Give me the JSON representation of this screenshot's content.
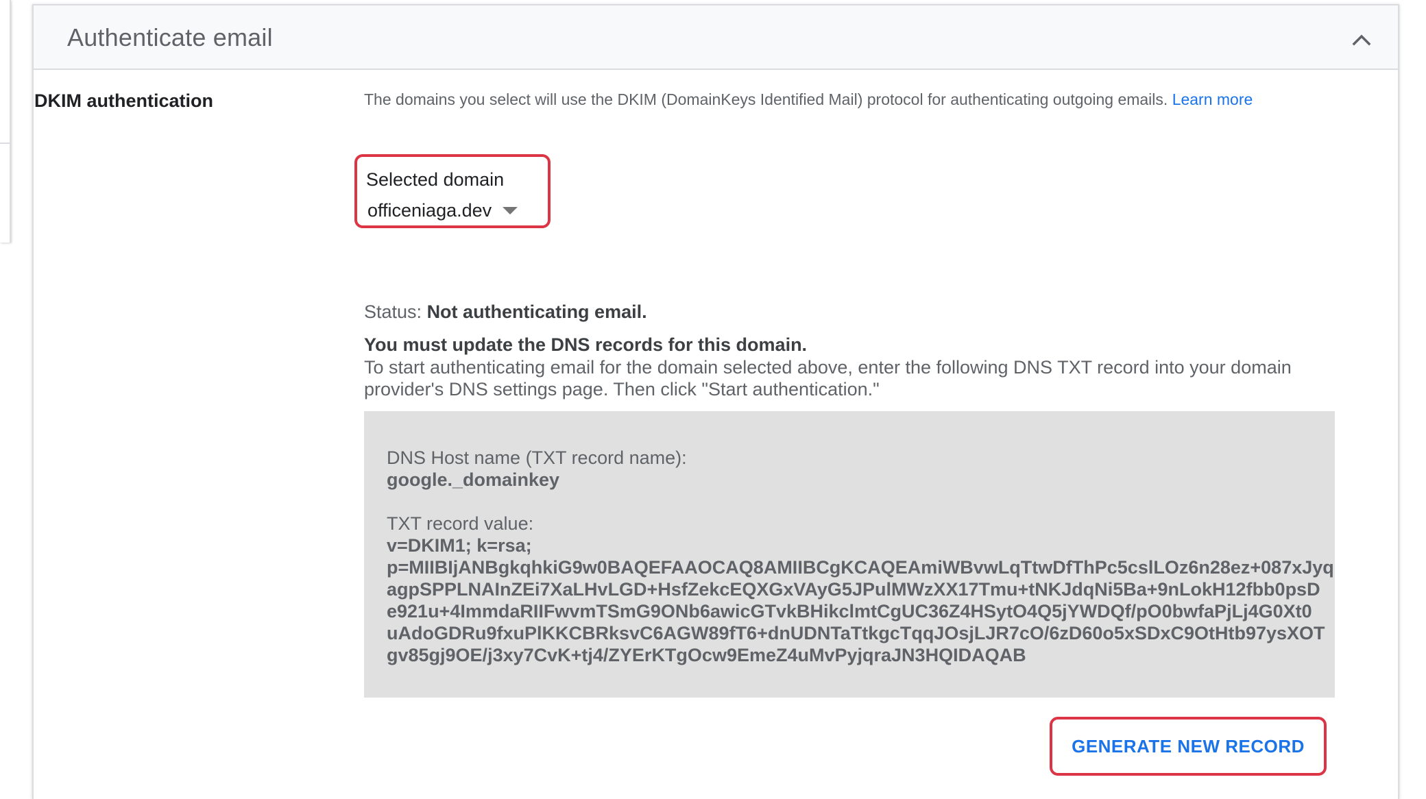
{
  "panel": {
    "title": "Authenticate email",
    "collapse_icon": "chevron-up-icon"
  },
  "dkim": {
    "label": "DKIM authentication",
    "description": "The domains you select will use the DKIM (DomainKeys Identified Mail) protocol for authenticating outgoing emails.",
    "learn_more": "Learn more"
  },
  "domain": {
    "label": "Selected domain",
    "value": "officeniaga.dev",
    "dropdown_icon": "caret-down-icon"
  },
  "status": {
    "prefix": "Status:",
    "value": "Not authenticating email."
  },
  "update": {
    "title": "You must update the DNS records for this domain.",
    "text": "To start authenticating email for the domain selected above, enter the following DNS TXT record into your domain provider's DNS settings page. Then click \"Start authentication.\""
  },
  "dns": {
    "host_label": "DNS Host name (TXT record name):",
    "host_value": "google._domainkey",
    "txt_label": "TXT record value:",
    "txt_lines": [
      "v=DKIM1; k=rsa;",
      "p=MIIBIjANBgkqhkiG9w0BAQEFAAOCAQ8AMIIBCgKCAQEAmiWBvwLqTtwDfThPc5cslLOz6n28ez+087xJyq",
      "agpSPPLNAInZEi7XaLHvLGD+HsfZekcEQXGxVAyG5JPulMWzXX17Tmu+tNKJdqNi5Ba+9nLokH12fbb0psD",
      "e921u+4ImmdaRIIFwvmTSmG9ONb6awicGTvkBHikclmtCgUC36Z4HSytO4Q5jYWDQf/pO0bwfaPjLj4G0Xt0",
      "uAdoGDRu9fxuPlKKCBRksvC6AGW89fT6+dnUDNTaTtkgcTqqJOsjLJR7cO/6zD60o5xSDxC9OtHtb97ysXOT",
      "gv85gj9OE/j3xy7CvK+tj4/ZYErKTgOcw9EmeZ4uMvPyjqraJN3HQIDAQAB"
    ]
  },
  "actions": {
    "generate": "GENERATE NEW RECORD"
  },
  "colors": {
    "highlight": "#dc3545",
    "link": "#1a73e8",
    "record_box": "#e0e0e0"
  }
}
